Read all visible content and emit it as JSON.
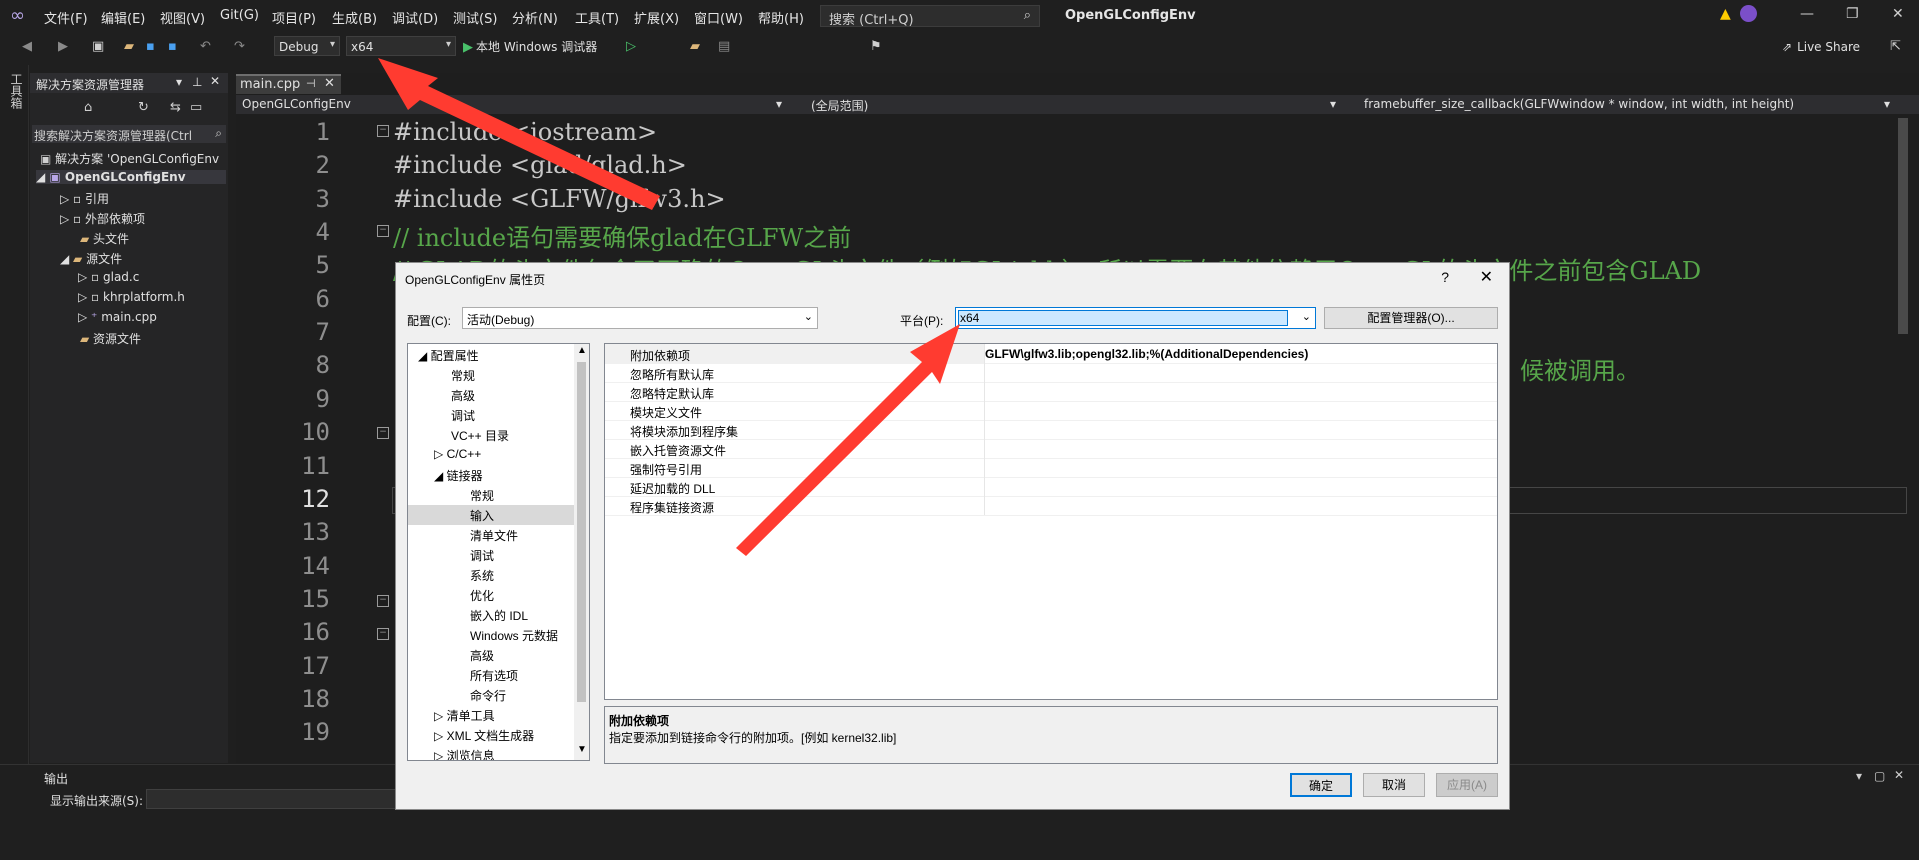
{
  "menu": [
    "文件(F)",
    "编辑(E)",
    "视图(V)",
    "Git(G)",
    "项目(P)",
    "生成(B)",
    "调试(D)",
    "测试(S)",
    "分析(N)",
    "工具(T)",
    "扩展(X)",
    "窗口(W)",
    "帮助(H)"
  ],
  "search_label": "搜索 (Ctrl+Q)",
  "app_title": "OpenGLConfigEnv",
  "toolbar": {
    "config": "Debug",
    "platform": "x64",
    "run_label": "本地 Windows 调试器",
    "live_share": "Live Share"
  },
  "left_strip": "工具箱",
  "solution_explorer": {
    "title": "解决方案资源管理器",
    "search": "搜索解决方案资源管理器(Ctrl",
    "items": [
      "解决方案 'OpenGLConfigEnv",
      "OpenGLConfigEnv",
      "引用",
      "外部依赖项",
      "头文件",
      "源文件",
      "glad.c",
      "khrplatform.h",
      "main.cpp",
      "资源文件"
    ]
  },
  "editor": {
    "tab": "main.cpp",
    "nav": {
      "project": "OpenGLConfigEnv",
      "scope": "(全局范围)",
      "member": "framebuffer_size_callback(GLFWwindow * window, int width, int height)"
    },
    "line_numbers": [
      "1",
      "2",
      "3",
      "4",
      "5",
      "6",
      "7",
      "8",
      "9",
      "10",
      "11",
      "12",
      "13",
      "14",
      "15",
      "16",
      "17",
      "18",
      "19"
    ],
    "lines": [
      "#include <iostream>",
      "#include <glad/glad.h>",
      "#include <GLFW/glfw3.h>",
      "// include语句需要确保glad在GLFW之前",
      "// GLAD的头文件包含了正确的OpenGL头文件（例如GL/gl.h），所以需要在其他依赖于OpenGL的头文件之前包含GLAD",
      "候被调用。"
    ]
  },
  "output": {
    "title": "输出",
    "source_label": "显示输出来源(S):"
  },
  "dialog": {
    "title": "OpenGLConfigEnv 属性页",
    "help": "?",
    "config_label": "配置(C):",
    "config_value": "活动(Debug)",
    "platform_label": "平台(P):",
    "platform_value": "x64",
    "config_manager": "配置管理器(O)...",
    "tree": [
      "配置属性",
      "常规",
      "高级",
      "调试",
      "VC++ 目录",
      "C/C++",
      "链接器",
      "常规",
      "输入",
      "清单文件",
      "调试",
      "系统",
      "优化",
      "嵌入的 IDL",
      "Windows 元数据",
      "高级",
      "所有选项",
      "命令行",
      "清单工具",
      "XML 文档生成器",
      "浏览信息"
    ],
    "grid_keys": [
      "附加依赖项",
      "忽略所有默认库",
      "忽略特定默认库",
      "模块定义文件",
      "将模块添加到程序集",
      "嵌入托管资源文件",
      "强制符号引用",
      "延迟加载的 DLL",
      "程序集链接资源"
    ],
    "grid_value0": "GLFW\\glfw3.lib;opengl32.lib;%(AdditionalDependencies)",
    "desc_title": "附加依赖项",
    "desc_text": "指定要添加到链接命令行的附加项。[例如 kernel32.lib]",
    "ok": "确定",
    "cancel": "取消",
    "apply": "应用(A)"
  },
  "colors": {
    "accent": "#ff3b30",
    "comment": "#57a64a",
    "selection": "#cce8ff"
  }
}
